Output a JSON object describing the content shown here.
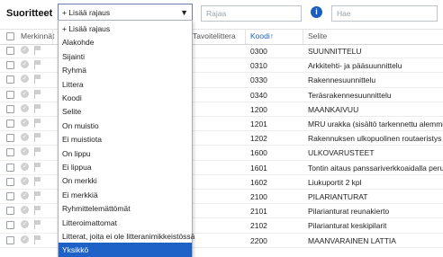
{
  "header": {
    "title": "Suoritteet",
    "filter_value": "+ Lisää rajaus",
    "rajaa_placeholder": "Rajaa",
    "search_placeholder": "Hae"
  },
  "table": {
    "columns": {
      "merkinnat": "Merkinnät",
      "tavoitelittera": "Tavoitelittera",
      "koodi": "Koodi",
      "koodi_sort": "↑",
      "selite": "Selite"
    },
    "rows": [
      {
        "koodi": "0300",
        "selite": "SUUNNITTELU"
      },
      {
        "koodi": "0310",
        "selite": "Arkkitehti- ja pääsuunnittelu"
      },
      {
        "koodi": "0330",
        "selite": "Rakennesuunnittelu"
      },
      {
        "koodi": "0340",
        "selite": "Teräsrakennesuunnittelu"
      },
      {
        "koodi": "1200",
        "selite": "MAANKAIVUU"
      },
      {
        "koodi": "1201",
        "selite": "MRU urakka (sisältö tarkennettu alemmille r"
      },
      {
        "koodi": "1202",
        "selite": "Rakennuksen ulkopuolinen routaeristys"
      },
      {
        "koodi": "1600",
        "selite": "ULKOVARUSTEET"
      },
      {
        "koodi": "1601",
        "selite": "Tontin aitaus panssariverkkoaidalla perustuk"
      },
      {
        "koodi": "1602",
        "selite": "Liukuportit 2 kpl"
      },
      {
        "koodi": "2100",
        "selite": "PILARIANTURAT"
      },
      {
        "koodi": "2101",
        "selite": "Pilarianturat reunakierto"
      },
      {
        "koodi": "2102",
        "selite": "Pilarianturat keskipilarit"
      },
      {
        "koodi": "2200",
        "selite": "MAANVARAINEN LATTIA"
      }
    ]
  },
  "dropdown": {
    "options": [
      "+ Lisää rajaus",
      "Alakohde",
      "Sijainti",
      "Ryhmä",
      "Littera",
      "Koodi",
      "Selite",
      "On muistio",
      "Ei muistiota",
      "On lippu",
      "Ei lippua",
      "On merkki",
      "Ei merkkiä",
      "Ryhmittelemättömät",
      "Litteroimattomat",
      "Litterat, joita ei ole litteranimikkeistössä",
      "Yksikkö"
    ],
    "selected_index": 16
  },
  "colors": {
    "accent": "#1e62c7",
    "info": "#1a5fbf"
  }
}
